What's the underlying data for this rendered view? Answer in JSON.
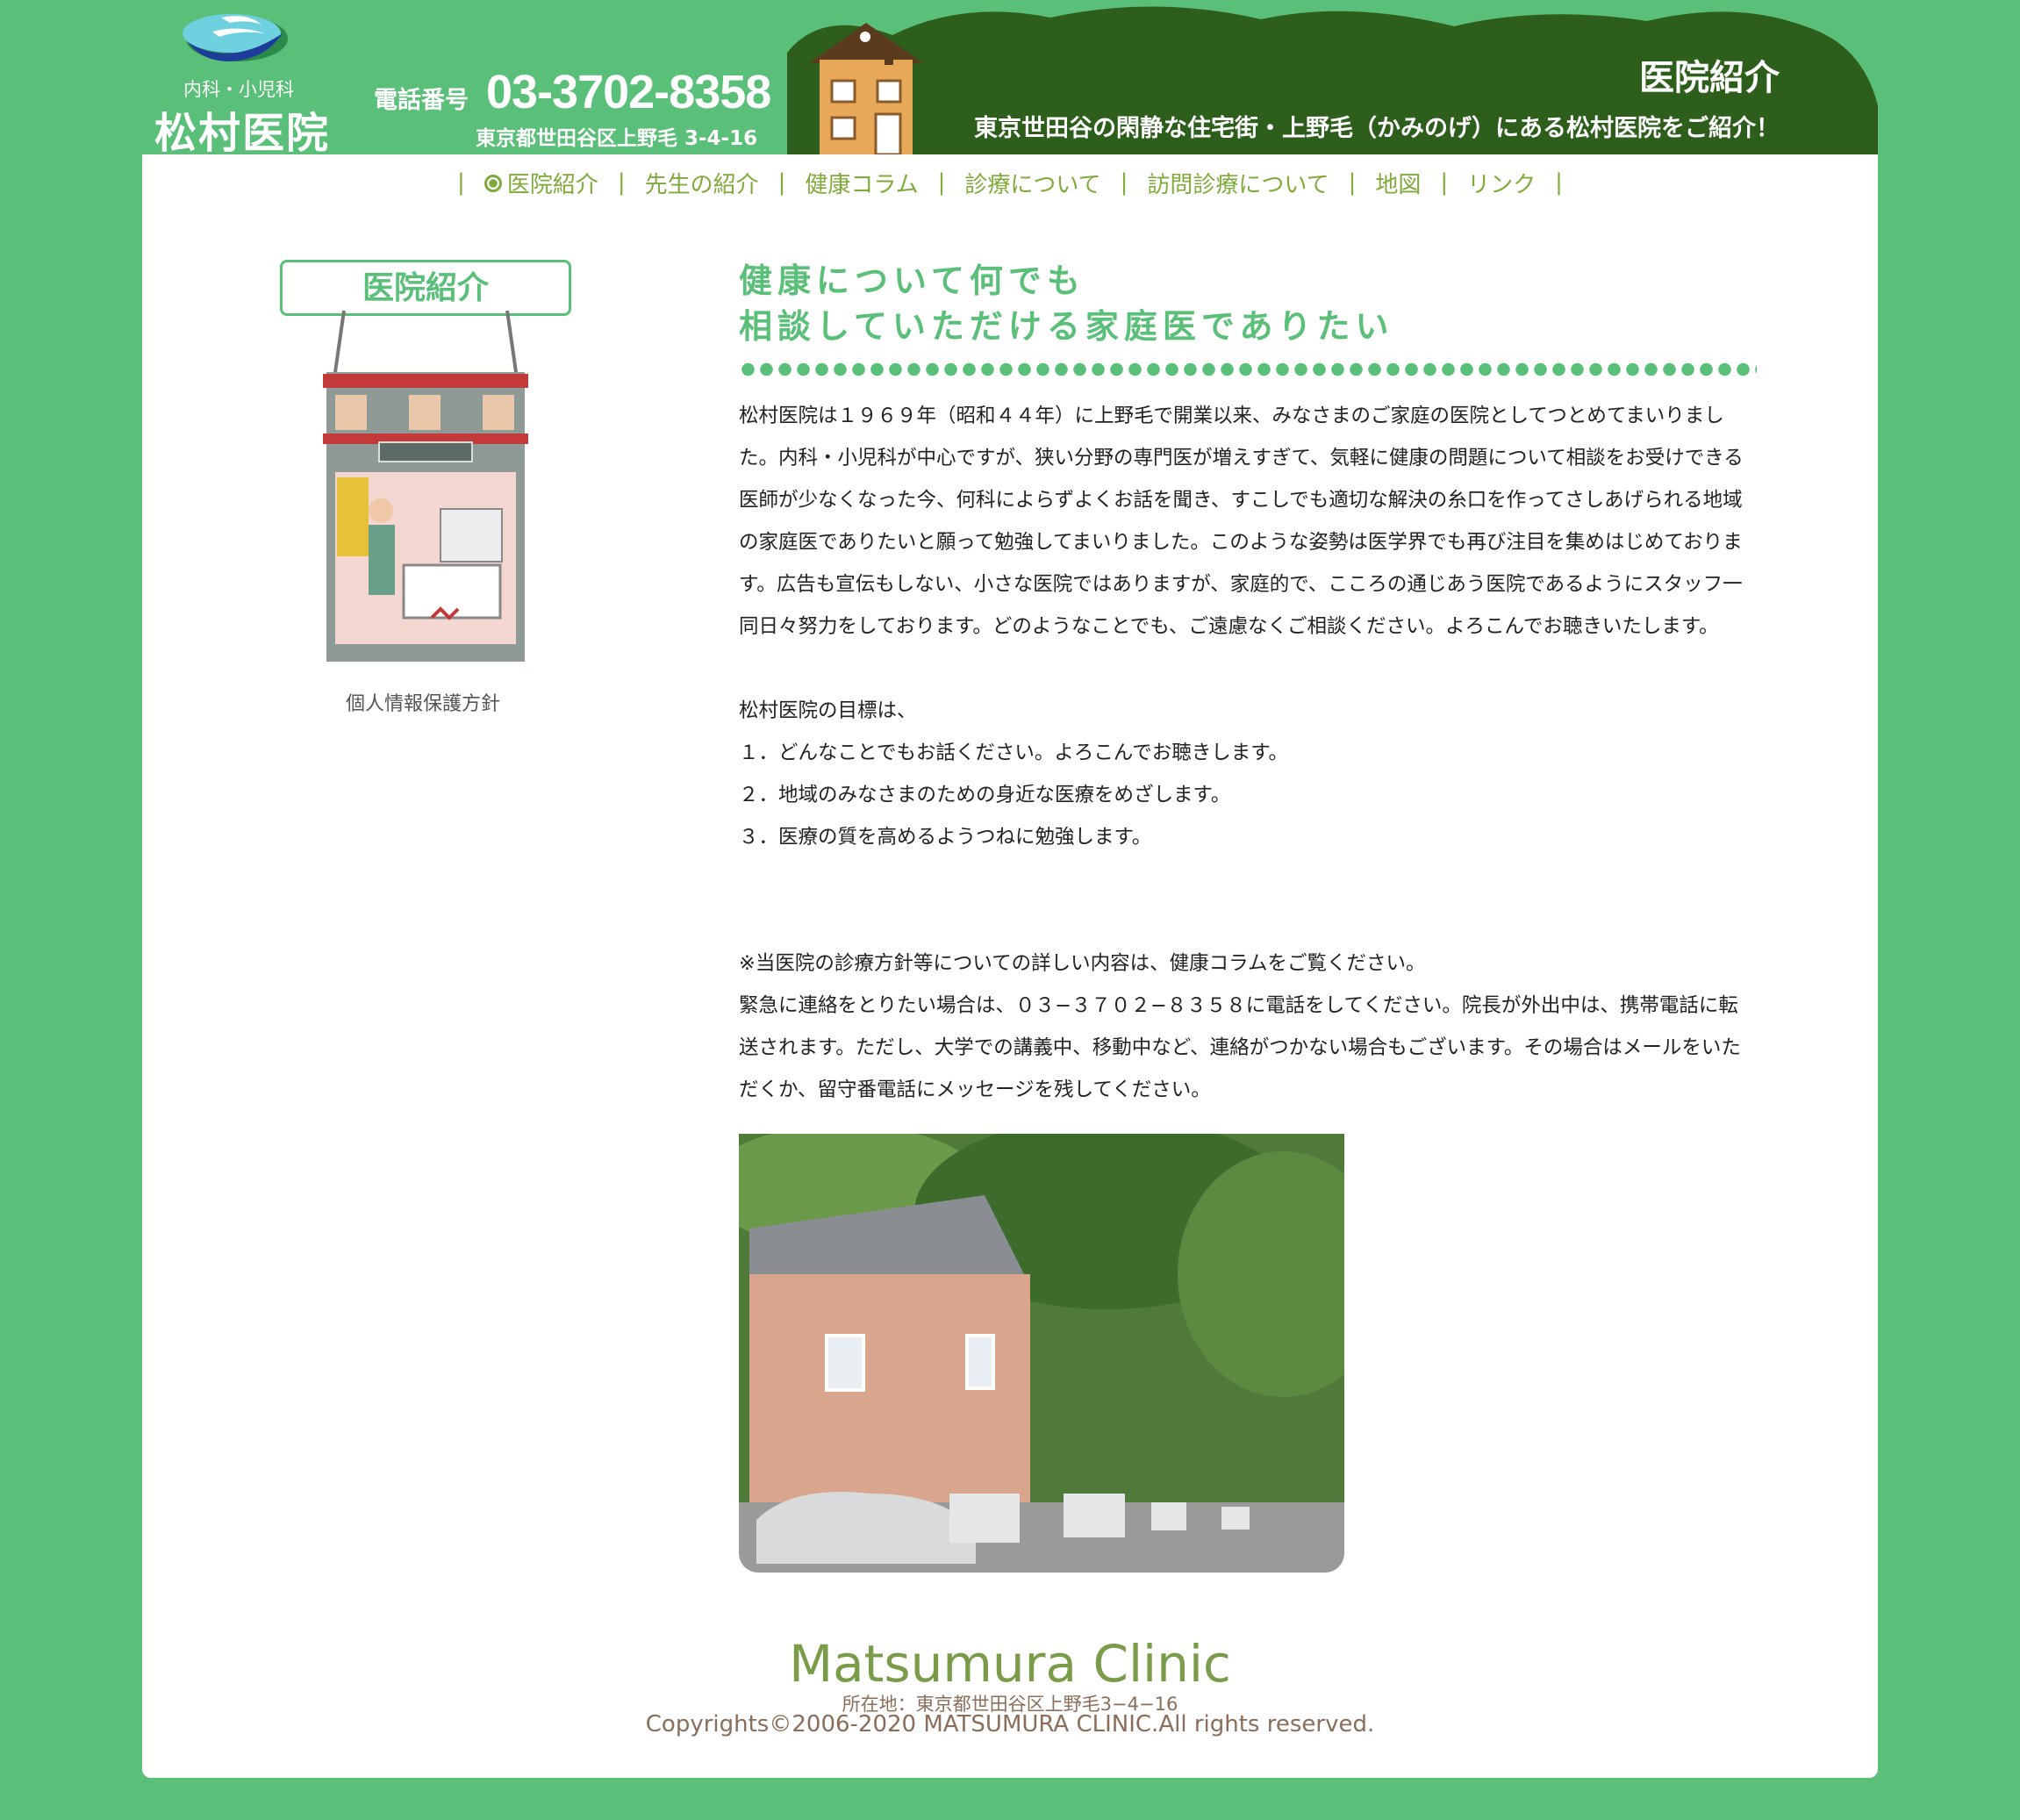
{
  "header": {
    "logo_sub": "内科・小児科",
    "logo_name": "松村医院",
    "phone_label": "電話番号",
    "phone_number": "03-3702-8358",
    "address": "東京都世田谷区上野毛 3-4-16",
    "section_title": "医院紹介",
    "section_subtitle": "東京世田谷の閑静な住宅街・上野毛（かみのげ）にある松村医院をご紹介！"
  },
  "nav": {
    "items": [
      "医院紹介",
      "先生の紹介",
      "健康コラム",
      "診療について",
      "訪問診療について",
      "地図",
      "リンク"
    ],
    "separator": "|"
  },
  "sidebar": {
    "title": "医院紹介",
    "privacy_link": "個人情報保護方針"
  },
  "main": {
    "heading_line1": "健康について何でも",
    "heading_line2": "相談していただける家庭医でありたい",
    "intro": "松村医院は１９６９年（昭和４４年）に上野毛で開業以来、みなさまのご家庭の医院としてつとめてまいりました。内科・小児科が中心ですが、狭い分野の専門医が増えすぎて、気軽に健康の問題について相談をお受けできる医師が少なくなった今、何科によらずよくお話を聞き、すこしでも適切な解決の糸口を作ってさしあげられる地域の家庭医でありたいと願って勉強してまいりました。このような姿勢は医学界でも再び注目を集めはじめております。広告も宣伝もしない、小さな医院ではありますが、家庭的で、こころの通じあう医院であるようにスタッフ一同日々努力をしております。どのようなことでも、ご遠慮なくご相談ください。よろこんでお聴きいたします。",
    "goals_intro": "松村医院の目標は、",
    "goals": [
      "１．どんなことでもお話ください。よろこんでお聴きします。",
      "２．地域のみなさまのための身近な医療をめざします。",
      "３．医療の質を高めるようつねに勉強します。"
    ],
    "notice_1": "※当医院の診療方針等についての詳しい内容は、健康コラムをご覧ください。",
    "notice_2": "緊急に連絡をとりたい場合は、０３−３７０２−８３５８に電話をしてください。院長が外出中は、携帯電話に転送されます。ただし、大学での講義中、移動中など、連絡がつかない場合もございます。その場合はメールをいただくか、留守番電話にメッセージを残してください。"
  },
  "footer": {
    "name": "Matsumura Clinic",
    "address": "所在地：東京都世田谷区上野毛3−4−16",
    "copyright": "Copyrights©2006-2020 MATSUMURA CLINIC.All rights reserved."
  },
  "colors": {
    "background_green": "#5abf78",
    "header_dark_green": "#2d5e1c",
    "nav_text": "#7fab3a",
    "footer_brown": "#8a6d5a"
  },
  "icons": [
    "clinic-logo-icon",
    "house-illustration",
    "clinic-sign-illustration",
    "clinic-building-photo"
  ]
}
